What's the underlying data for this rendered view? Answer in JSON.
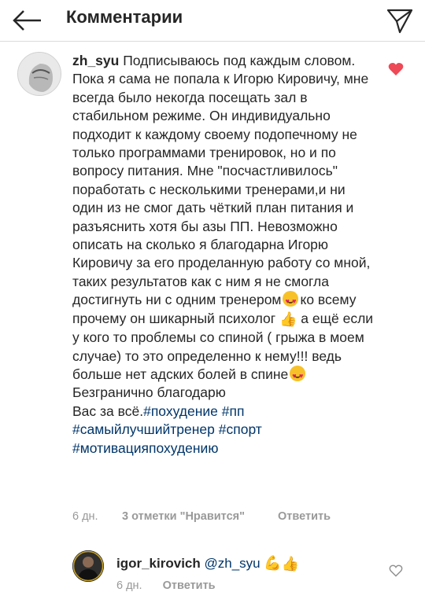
{
  "header": {
    "title": "Комментарии",
    "back_icon": "arrow-left-icon",
    "send_icon": "paper-plane-icon"
  },
  "comment": {
    "username": "zh_syu",
    "text_1": " Подписываюсь под каждым словом. Пока я сама  не попала к Игорю Кировичу, мне всегда было некогда посещать зал в стабильном режиме. Он  индивидуально подходит к каждому своему подопечному не только программами тренировок, но и по вопросу питания. Мне \"посчастливилось\" поработать с несколькими тренерами,и ни один из не смог дать чёткий план питания и разъяснить хотя бы азы ПП. Невозможно описать на сколько я благодарна Игорю Кировичу за его проделанную работу со мной, таких результатов как с ним я не смогла достигнуть ни с одним тренером",
    "text_2": "ко всему прочему он шикарный психолог ",
    "text_3": "  а ещё если у кого то проблемы со спиной ( грыжа в моем случае) то это определенно к нему!!! ведь больше нет адских болей в спине",
    "text_4": "Безгранично благодарю",
    "text_5": "Вас за всё.",
    "tags": [
      "#похудение",
      "#пп",
      "#самыйлучшийтренер",
      "#спорт",
      "#мотивацияпохудению"
    ],
    "liked": true,
    "heart_color": "#ed4956",
    "time": "6 дн.",
    "likes": "3 отметки \"Нравится\"",
    "reply_label": "Ответить"
  },
  "reply": {
    "username": "igor_kirovich",
    "mention": "@zh_syu",
    "time": "6 дн.",
    "reply_label": "Ответить"
  },
  "colors": {
    "hashtag": "#003569",
    "meta": "#999999",
    "text": "#262626"
  }
}
